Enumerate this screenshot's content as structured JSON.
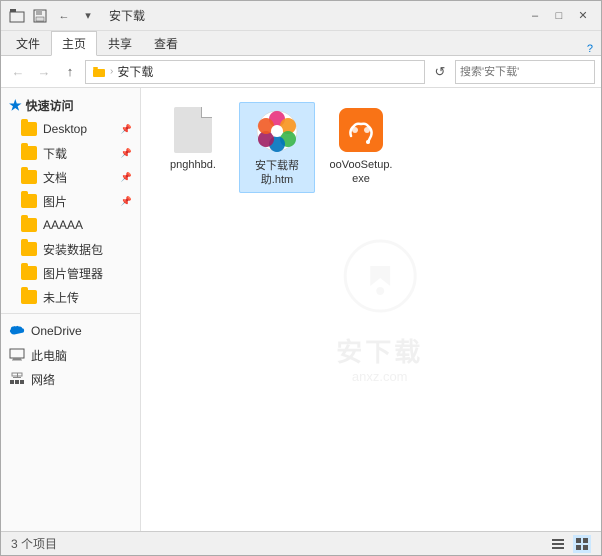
{
  "window": {
    "title": "安下载",
    "quick_access_tooltip": "自定义快速访问工具栏"
  },
  "ribbon": {
    "tabs": [
      "文件",
      "主页",
      "共享",
      "查看"
    ],
    "active_tab": "主页"
  },
  "address_bar": {
    "path_parts": [
      "安下载"
    ],
    "path_separator": "›",
    "search_placeholder": "搜索'安下载'",
    "refresh_icon": "↺"
  },
  "sidebar": {
    "quick_access_label": "快速访问",
    "items": [
      {
        "label": "Desktop",
        "type": "folder",
        "pinned": true
      },
      {
        "label": "下载",
        "type": "folder",
        "pinned": true
      },
      {
        "label": "文档",
        "type": "folder",
        "pinned": true
      },
      {
        "label": "图片",
        "type": "folder",
        "pinned": true
      },
      {
        "label": "AAAAA",
        "type": "folder",
        "pinned": false
      },
      {
        "label": "安装数据包",
        "type": "folder",
        "pinned": false
      },
      {
        "label": "图片管理器",
        "type": "folder",
        "pinned": false
      },
      {
        "label": "未上传",
        "type": "folder",
        "pinned": false
      }
    ],
    "system_items": [
      {
        "label": "OneDrive",
        "type": "onedrive"
      },
      {
        "label": "此电脑",
        "type": "pc"
      },
      {
        "label": "网络",
        "type": "network"
      }
    ]
  },
  "files": [
    {
      "name": "pnghhbd.",
      "type": "generic",
      "id": "file1"
    },
    {
      "name": "安下载帮助.htm",
      "type": "htm",
      "id": "file2",
      "selected": true
    },
    {
      "name": "ooVooSetup.exe",
      "type": "exe",
      "id": "file3"
    }
  ],
  "watermark": {
    "text": "安下载",
    "sub": "anxz.com"
  },
  "status_bar": {
    "item_count": "3 个项目",
    "view_list_label": "列表视图",
    "view_tile_label": "平铺视图"
  }
}
